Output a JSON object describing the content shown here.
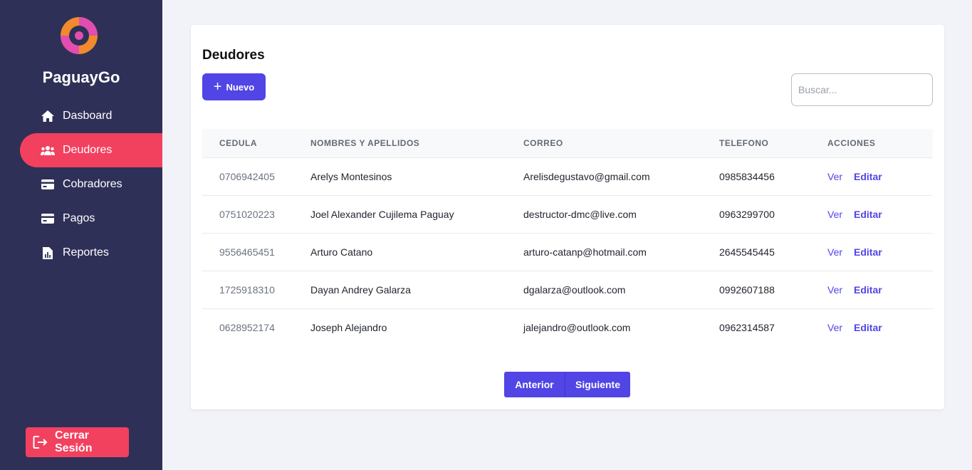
{
  "app": {
    "name": "PaguayGo"
  },
  "sidebar": {
    "items": [
      {
        "label": "Dasboard",
        "icon": "home-icon"
      },
      {
        "label": "Deudores",
        "icon": "users-icon",
        "active": true
      },
      {
        "label": "Cobradores",
        "icon": "card-icon"
      },
      {
        "label": "Pagos",
        "icon": "card-icon"
      },
      {
        "label": "Reportes",
        "icon": "report-icon"
      }
    ],
    "logout_label": "Cerrar Sesión"
  },
  "main": {
    "title": "Deudores",
    "new_button_label": "Nuevo",
    "search_placeholder": "Buscar...",
    "table": {
      "headers": [
        "CEDULA",
        "NOMBRES Y APELLIDOS",
        "CORREO",
        "TELEFONO",
        "ACCIONES"
      ],
      "rows": [
        {
          "cedula": "0706942405",
          "nombre": "Arelys Montesinos",
          "correo": "Arelisdegustavo@gmail.com",
          "telefono": "0985834456"
        },
        {
          "cedula": "0751020223",
          "nombre": "Joel Alexander Cujilema Paguay",
          "correo": "destructor-dmc@live.com",
          "telefono": "0963299700"
        },
        {
          "cedula": "9556465451",
          "nombre": "Arturo Catano",
          "correo": "arturo-catanp@hotmail.com",
          "telefono": "2645545445"
        },
        {
          "cedula": "1725918310",
          "nombre": "Dayan Andrey Galarza",
          "correo": "dgalarza@outlook.com",
          "telefono": "0992607188"
        },
        {
          "cedula": "0628952174",
          "nombre": "Joseph Alejandro",
          "correo": "jalejandro@outlook.com",
          "telefono": "0962314587"
        }
      ],
      "action_view": "Ver",
      "action_edit": "Editar"
    },
    "pagination": {
      "prev_label": "Anterior",
      "next_label": "Siguiente"
    }
  },
  "colors": {
    "sidebar": "#2f3057",
    "accent": "#f2405f",
    "primary": "#5145e5"
  }
}
